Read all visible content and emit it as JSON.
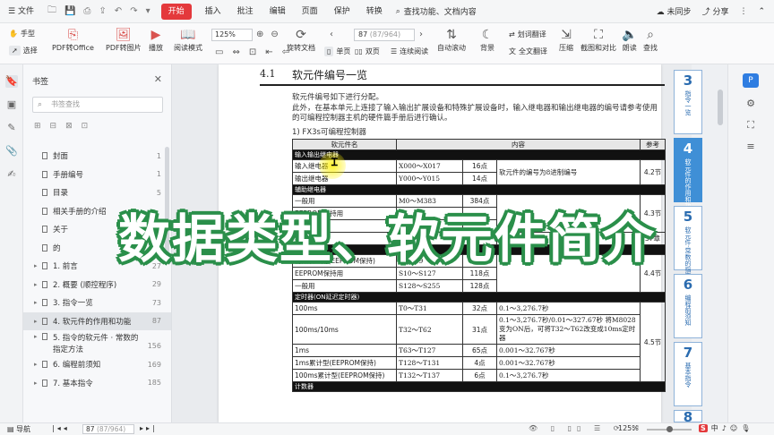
{
  "menubar": {
    "file_label": "文件",
    "tabs": [
      "开始",
      "插入",
      "批注",
      "编辑",
      "页面",
      "保护",
      "转换"
    ],
    "active_tab": "开始",
    "search_label": "查找功能、文档内容",
    "sync_label": "未同步",
    "share_label": "分享"
  },
  "toolbar": {
    "hand_label": "手型",
    "select_label": "选择",
    "pdf_to_office": "PDF转Office",
    "pdf_to_image": "PDF转图片",
    "play": "播放",
    "reading_mode": "阅读模式",
    "zoom_value": "125%",
    "rotate_doc": "旋转文档",
    "single_page": "单页",
    "double_page": "双页",
    "continuous": "连续阅读",
    "auto_scroll": "自动滚动",
    "page_current": "87",
    "page_total": "(87/964)",
    "background": "背景",
    "word_translate": "划词翻译",
    "full_translate": "全文翻译",
    "compress": "压缩",
    "screenshot_compare": "截图和对比",
    "read_aloud": "朗读",
    "find": "查找"
  },
  "panel": {
    "title": "书签",
    "search_placeholder": "书签查找",
    "items": [
      {
        "label": "封面",
        "page": "1",
        "arrow": ""
      },
      {
        "label": "手册编号",
        "page": "1",
        "arrow": ""
      },
      {
        "label": "目录",
        "page": "5",
        "arrow": ""
      },
      {
        "label": "相关手册的介绍",
        "page": "",
        "arrow": ""
      },
      {
        "label": "关于",
        "page": "",
        "arrow": ""
      },
      {
        "label": "的",
        "page": "",
        "arrow": ""
      },
      {
        "label": "1. 前言",
        "page": "27",
        "arrow": "▸"
      },
      {
        "label": "2. 概要 (顺控程序)",
        "page": "29",
        "arrow": "▸"
      },
      {
        "label": "3. 指令一览",
        "page": "73",
        "arrow": "▸"
      },
      {
        "label": "4. 软元件的作用和功能",
        "page": "87",
        "arrow": "▸"
      },
      {
        "label": "5. 指令的软元件 · 常数的指定方法",
        "page": "156",
        "arrow": "▸"
      },
      {
        "label": "6. 编程前须知",
        "page": "169",
        "arrow": "▸"
      },
      {
        "label": "7. 基本指令",
        "page": "185",
        "arrow": "▸"
      }
    ]
  },
  "document": {
    "section_number": "4.1",
    "section_title": "软元件编号一览",
    "intro_line1": "软元件编号如下进行分配。",
    "intro_line2": "此外，在基本单元上连接了输入输出扩展设备和特殊扩展设备时，输入继电器和输出继电器的编号请参考使用",
    "intro_line3": "的可编程控制器主机的硬件篇手册后进行确认。",
    "subheading": "1)  FX3s可编程控制器",
    "table_headers": [
      "软元件名",
      "内容",
      "参考"
    ],
    "group_io": "输入输出继电器",
    "row_input": {
      "name": "输入继电器",
      "range": "X000～X017",
      "count": "16点"
    },
    "row_output": {
      "name": "输出继电器",
      "range": "Y000～Y015",
      "count": "14点"
    },
    "io_note": "软元件的编号为8进制编号",
    "io_ref": "4.2节",
    "group_aux": "辅助继电器",
    "row_aux_general": {
      "name": "一般用",
      "range": "M0～M383",
      "count": "384点"
    },
    "row_aux_eeprom": {
      "name": "EEPROM保持用",
      "range": "",
      "count": ""
    },
    "row_aux_general2": {
      "name": "一般用",
      "range": "",
      "count": ""
    },
    "row_special": {
      "name": "特殊用*1",
      "range": "M8",
      "count": ""
    },
    "aux_ref": "4.3节",
    "special_ref": "37章",
    "group_state": "状态",
    "row_state_init": {
      "name": "初始状态用(EEPROM保持)",
      "range": "S0～S9",
      "count": "10点"
    },
    "row_state_eeprom": {
      "name": "EEPROM保持用",
      "range": "S10～S127",
      "count": "118点"
    },
    "row_state_general": {
      "name": "一般用",
      "range": "S128～S255",
      "count": "128点"
    },
    "state_ref": "4.4节",
    "group_timer": "定时器(ON延迟定时器)",
    "row_t100": {
      "name": "100ms",
      "range": "T0～T31",
      "count": "32点",
      "note": "0.1～3,276.7秒"
    },
    "row_t100_10": {
      "name": "100ms/10ms",
      "range": "T32～T62",
      "count": "31点",
      "note": "0.1～3,276.7秒/0.01～327.67秒 将M8028变为ON后，可将T32～T62改变成10ms定时器"
    },
    "row_t1": {
      "name": "1ms",
      "range": "T63～T127",
      "count": "65点",
      "note": "0.001～32.767秒"
    },
    "row_t1acc": {
      "name": "1ms累计型(EEPROM保持)",
      "range": "T128～T131",
      "count": "4点",
      "note": "0.001～32.767秒"
    },
    "row_t100acc": {
      "name": "100ms累计型(EEPROM保持)",
      "range": "T132～T137",
      "count": "6点",
      "note": "0.1～3,276.7秒"
    },
    "timer_ref": "4.5节",
    "group_counter": "计数器"
  },
  "chapter_tabs": [
    {
      "num": "3",
      "text": "指令一览"
    },
    {
      "num": "4",
      "text": "软元件的作用和功能"
    },
    {
      "num": "5",
      "text": "软元件·常数的指定方法"
    },
    {
      "num": "6",
      "text": "编程前须知"
    },
    {
      "num": "7",
      "text": "基本指令"
    },
    {
      "num": "8",
      "text": ""
    }
  ],
  "status": {
    "nav_label": "导航",
    "page_current": "87",
    "page_total": "(87/964)",
    "zoom": "125%"
  },
  "banner": {
    "text": "数据类型、软元件简介"
  },
  "colors": {
    "accent_red": "#e4393c",
    "tab_blue": "#3f8fd6",
    "banner_outline": "#2a8f4a"
  }
}
